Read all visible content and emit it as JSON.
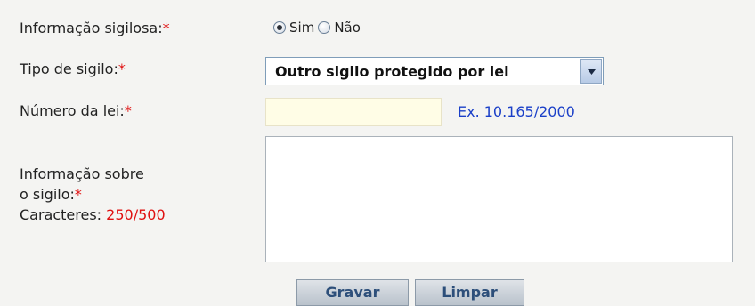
{
  "form": {
    "confidential": {
      "label": "Informação sigilosa:",
      "required_mark": "*",
      "options": [
        {
          "label": "Sim",
          "checked": true
        },
        {
          "label": "Não",
          "checked": false
        }
      ]
    },
    "secrecy_type": {
      "label": "Tipo de sigilo:",
      "required_mark": "*",
      "selected": "Outro sigilo protegido por lei"
    },
    "law_number": {
      "label": "Número da lei:",
      "required_mark": "*",
      "value": "",
      "example": "Ex. 10.165/2000"
    },
    "info": {
      "label_line1": "Informação sobre",
      "label_line2": "o sigilo:",
      "required_mark": "*",
      "counter_label": "Caracteres:",
      "counter_value": "250/500",
      "value": ""
    }
  },
  "buttons": {
    "save": "Gravar",
    "clear": "Limpar"
  },
  "colors": {
    "required": "#e01010",
    "example_text": "#1a3fc8",
    "button_text": "#2d4f7a"
  },
  "icons": {
    "dropdown": "chevron-down-icon"
  }
}
